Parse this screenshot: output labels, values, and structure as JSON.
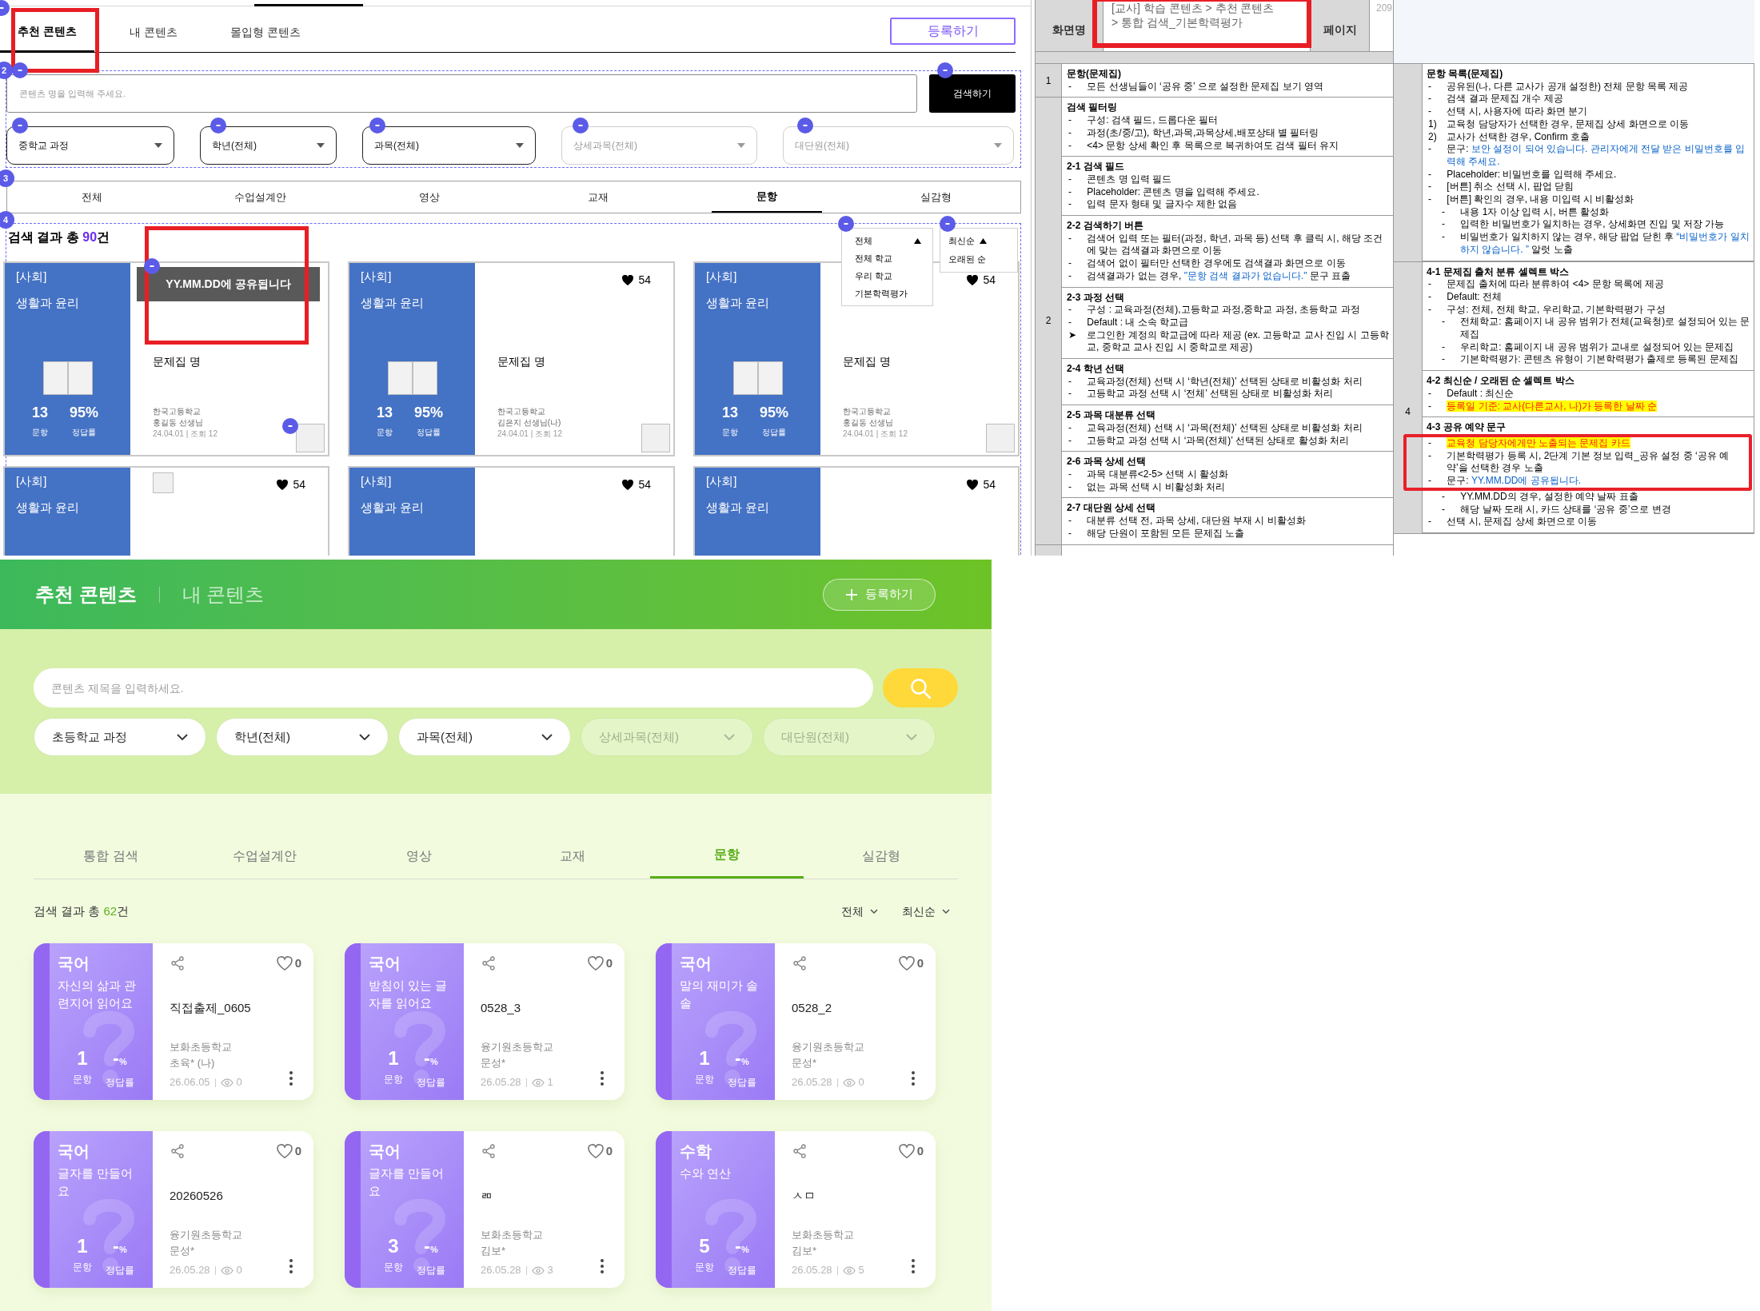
{
  "wireframe": {
    "top_tabs": [
      {
        "label": "추천 콘텐츠",
        "selected": true,
        "highlighted": true
      },
      {
        "label": "내 콘텐츠",
        "selected": false,
        "highlighted": false
      },
      {
        "label": "몰입형 콘텐츠",
        "selected": false,
        "highlighted": false
      }
    ],
    "register_button": "등록하기",
    "section_markers": [
      "2",
      "3",
      "4"
    ],
    "search": {
      "placeholder": "콘텐츠 명을 입력해 주세요.",
      "button": "검색하기"
    },
    "filters": [
      {
        "label": "중학교 과정",
        "disabled": false
      },
      {
        "label": "학년(전체)",
        "disabled": false
      },
      {
        "label": "과목(전체)",
        "disabled": false
      },
      {
        "label": "상세과목(전체)",
        "disabled": true
      },
      {
        "label": "대단원(전체)",
        "disabled": true
      }
    ],
    "category_tabs": [
      {
        "label": "전체",
        "selected": false
      },
      {
        "label": "수업설계안",
        "selected": false
      },
      {
        "label": "영상",
        "selected": false
      },
      {
        "label": "교재",
        "selected": false
      },
      {
        "label": "문항",
        "selected": true
      },
      {
        "label": "실감형",
        "selected": false
      }
    ],
    "result": {
      "label": "검색 결과 총",
      "count": "90",
      "unit": "건"
    },
    "source_menu": [
      {
        "label": "전체",
        "selected": true
      },
      {
        "label": "전체 학교",
        "selected": false
      },
      {
        "label": "우리 학교",
        "selected": false
      },
      {
        "label": "기본학력평가",
        "selected": false
      }
    ],
    "sort_menu": [
      {
        "label": "최신순",
        "selected": true
      },
      {
        "label": "오래된 순",
        "selected": false
      }
    ],
    "cards": [
      {
        "kind": "full",
        "subject": "[사회]",
        "course": "생활과 윤리",
        "question_count": "13",
        "accuracy": "95%",
        "count_label": "문항",
        "accuracy_label": "정답률",
        "notice": "YY.MM.DD에 공유됩니다",
        "title": "문제집 명",
        "school": "한국고등학교",
        "author": "홍길동 선생님",
        "meta": "24.04.01 | 조회 12",
        "highlighted": true
      },
      {
        "kind": "full",
        "subject": "[사회]",
        "course": "생활과 윤리",
        "likes": "54",
        "question_count": "13",
        "accuracy": "95%",
        "count_label": "문항",
        "accuracy_label": "정답률",
        "title": "문제집 명",
        "school": "한국고등학교",
        "author": "김은지 선생님(나)",
        "meta": "24.04.01 | 조회 12",
        "highlighted": false
      },
      {
        "kind": "full",
        "subject": "[사회]",
        "course": "생활과 윤리",
        "likes": "54",
        "question_count": "13",
        "accuracy": "95%",
        "count_label": "문항",
        "accuracy_label": "정답률",
        "title": "문제집 명",
        "school": "한국고등학교",
        "author": "홍길동 선생님",
        "meta": "24.04.01 | 조회 12",
        "highlighted": false
      },
      {
        "kind": "tagged",
        "subject": "[사회]",
        "course": "생활과 윤리",
        "likes": "54",
        "highlighted": false
      },
      {
        "kind": "plain",
        "subject": "[사회]",
        "course": "생활과 윤리",
        "likes": "54",
        "highlighted": false
      },
      {
        "kind": "plain",
        "subject": "[사회]",
        "course": "생활과 윤리",
        "likes": "54",
        "highlighted": false
      }
    ]
  },
  "spec": {
    "header": {
      "label": "화면명",
      "title_lines": [
        "[교사] 학습 콘텐츠 > 추천 콘텐츠",
        "> 통합 검색_기본학력평가"
      ],
      "highlighted": true,
      "page_label": "페이지",
      "page": "209"
    },
    "left_rows": [
      {
        "number": "1",
        "sections": [
          {
            "title": "문항(문제집)",
            "items": [
              {
                "mark": "-",
                "text": "모든 선생님들이 ‘공유 중’ 으로 설정한 문제집 보기 영역"
              }
            ]
          }
        ]
      },
      {
        "number": "2",
        "sections": [
          {
            "title": "검색 필터링",
            "items": [
              {
                "mark": "-",
                "text": "구성: 검색 필드, 드롭다운 필터"
              },
              {
                "mark": "-",
                "text": "과정(초/중/고), 학년,과목,과목상세,배포상태 별 필터링"
              },
              {
                "mark": "-",
                "text": "<4> 문항 상세 확인 후 목록으로 복귀하여도 검색 필터 유지"
              }
            ]
          },
          {
            "title": "2-1 검색 필드",
            "items": [
              {
                "mark": "-",
                "text": "콘텐츠 명 입력 필드"
              },
              {
                "mark": "-",
                "text": "Placeholder: 콘텐츠 명을 입력해 주세요."
              },
              {
                "mark": "-",
                "text": "입력 문자 형태 및 글자수 제한 없음"
              }
            ]
          },
          {
            "title": "2-2 검색하기 버튼",
            "items": [
              {
                "mark": "-",
                "text": "검색어 입력 또는 필터(과정, 학년, 과목 등) 선택 후 클릭 시, 해당 조건에 맞는 검색결과 화면으로 이동"
              },
              {
                "mark": "-",
                "text": "검색어 없이 필터만 선택한 경우에도 검색결과 화면으로 이동"
              },
              {
                "mark": "-",
                "parts": [
                  {
                    "text": "검색결과가 없는 경우, ",
                    "kind": "plain"
                  },
                  {
                    "text": "\"문항 검색 결과가 없습니다.\"",
                    "kind": "quote"
                  },
                  {
                    "text": " 문구 표출",
                    "kind": "plain"
                  }
                ]
              }
            ]
          },
          {
            "title": "2-3 과정 선택",
            "items": [
              {
                "mark": "-",
                "text": "구성 : 교육과정(전체),고등학교 과정,중학교 과정, 초등학교 과정"
              },
              {
                "mark": "-",
                "text": "Default : 내 소속 학교급"
              },
              {
                "mark": "➤",
                "text": "로그인한 계정의 학교급에 따라 제공 (ex. 고등학교 교사 진입 시 고등학교, 중학교 교사 진입 시 중학교로 제공)"
              }
            ]
          },
          {
            "title": "2-4 학년 선택",
            "items": [
              {
                "mark": "-",
                "text": "교육과정(전체) 선택 시 ‘학년(전체)’ 선택된 상태로 비활성화 처리"
              },
              {
                "mark": "-",
                "text": "고등학교 과정 선택 시 ‘전체’ 선택된 상태로 비활성화 처리"
              }
            ]
          },
          {
            "title": "2-5 과목 대분류 선택",
            "items": [
              {
                "mark": "-",
                "text": "교육과정(전체) 선택 시 ‘과목(전체)’ 선택된 상태로 비활성화 처리"
              },
              {
                "mark": "-",
                "text": "고등학교 과정 선택 시 ‘과목(전체)’ 선택된 상태로 활성화 처리"
              }
            ]
          },
          {
            "title": "2-6 과목 상세 선택",
            "items": [
              {
                "mark": "-",
                "text": "과목 대분류<2-5> 선택 시 활성화"
              },
              {
                "mark": "-",
                "text": "없는 과목 선택 시 비활성화 처리"
              }
            ]
          },
          {
            "title": "2-7 대단원 상세 선택",
            "items": [
              {
                "mark": "-",
                "text": "대분류 선택 전, 과목 상세, 대단원 부재 시 비활성화"
              },
              {
                "mark": "-",
                "text": "해당 단원이 포함된 모든 문제집 노출"
              }
            ]
          }
        ]
      }
    ],
    "right_rows": [
      {
        "sections": [
          {
            "title": "문항 목록(문제집)",
            "items": [
              {
                "mark": "-",
                "text": "공유된(나, 다른 교사가 공개 설정한) 전체 문항 목록 제공"
              },
              {
                "mark": "-",
                "text": "검색 결과 문제집 개수 제공"
              },
              {
                "mark": "-",
                "text": "선택 시, 사용자에 따라  화면 분기"
              },
              {
                "mark": "1)",
                "text": "교육청 담당자가 선택한 경우, 문제집 상세 화면으로 이동"
              },
              {
                "mark": "2)",
                "text": "교사가 선택한 경우, Confirm 호출"
              },
              {
                "mark": "-",
                "parts": [
                  {
                    "text": "문구: ",
                    "kind": "plain"
                  },
                  {
                    "text": "보안 설정이 되어 있습니다. 관리자에게 전달 받은 비밀번호를 입력해 주세요.",
                    "kind": "quote"
                  }
                ]
              },
              {
                "mark": "-",
                "text": "Placeholder: 비밀번호를 입력해 주세요."
              },
              {
                "mark": "-",
                "text": "[버튼] 취소 선택 시, 팝업 닫힘"
              },
              {
                "mark": "-",
                "text": "[버튼] 확인의 경우, 내용 미입력 시 비활성화",
                "children": [
                  {
                    "mark": "-",
                    "text": "내용 1자 이상 입력 시, 버튼 활성화"
                  },
                  {
                    "mark": "-",
                    "text": "입력한 비밀번호가 일치하는 경우, 상세화면 진입 및 저장 가능"
                  },
                  {
                    "mark": "-",
                    "parts": [
                      {
                        "text": "비밀번호가 일치하지 않는 경우, 해당 팝업 닫힌 후 ",
                        "kind": "plain"
                      },
                      {
                        "text": "“비밀번호가 일치하지 않습니다. ”",
                        "kind": "quote"
                      },
                      {
                        "text": " 알럿 노출",
                        "kind": "plain"
                      }
                    ]
                  }
                ]
              }
            ]
          }
        ]
      },
      {
        "number": "4",
        "sections": [
          {
            "title": "4-1 문제집 출처 분류 셀렉트 박스",
            "items": [
              {
                "mark": "-",
                "text": "문제집 출처에 따라 분류하여 <4> 문항 목록에 제공"
              },
              {
                "mark": "-",
                "text": "Default:  전체"
              },
              {
                "mark": "-",
                "text": "구성: 전체, 전체 학교, 우리학교, 기본학력평가 구성",
                "children": [
                  {
                    "mark": "-",
                    "text": "전체학교: 홈페이지 내 공유 범위가 전체(교육청)로 설정되어 있는 문제집"
                  },
                  {
                    "mark": "-",
                    "text": "우리학교: 홈페이지 내 공유 범위가 교내로 설정되어 있는 문제집"
                  },
                  {
                    "mark": "-",
                    "text": "기본학력평가: 콘텐츠 유형이 기본학력평가 출제로 등록된 문제집"
                  }
                ]
              }
            ]
          },
          {
            "title": "4-2 최신순 / 오래된 순 셀렉트 박스",
            "items": [
              {
                "mark": "-",
                "text": "Default : 최신순"
              },
              {
                "mark": "-",
                "parts": [
                  {
                    "text": "등록일 기준: 교사(다른교사, 나)가 등록한 날짜 순",
                    "kind": "highlight"
                  }
                ]
              }
            ]
          },
          {
            "title": "4-3 공유 예약 문구",
            "items": [
              {
                "mark": "-",
                "parts": [
                  {
                    "text": "교육청 담당자에게만 노출되는 문제집 카드",
                    "kind": "highlight"
                  }
                ],
                "boxed": true
              },
              {
                "mark": "-",
                "text": "기본학력평가 등록 시, 2단계 기본 정보 입력_공유 설정 중 ‘공유 예약’을 선택한 경우 노출",
                "boxed": true
              },
              {
                "mark": "-",
                "parts": [
                  {
                    "text": "문구: ",
                    "kind": "plain"
                  },
                  {
                    "text": "YY.MM.DD에 공유됩니다.",
                    "kind": "quote"
                  }
                ],
                "boxed": true,
                "children": [
                  {
                    "mark": "-",
                    "text": "YY.MM.DD의 경우, 설정한 예약 날짜 표출",
                    "boxed": false
                  },
                  {
                    "mark": "-",
                    "text": "해당 날짜 도래 시, 카드 상태를 ‘공유 중’으로 변경",
                    "boxed": false
                  }
                ]
              },
              {
                "mark": "-",
                "text": "선택 시, 문제집 상세 화면으로 이동",
                "boxed": false
              }
            ]
          }
        ]
      }
    ]
  },
  "app": {
    "header_tabs": [
      {
        "label": "추천 콘텐츠",
        "selected": true
      },
      {
        "label": "내 콘텐츠",
        "selected": false
      }
    ],
    "register_button": "등록하기",
    "search": {
      "placeholder": "콘텐츠 제목을 입력하세요."
    },
    "filters": [
      {
        "label": "초등학교 과정",
        "disabled": false
      },
      {
        "label": "학년(전체)",
        "disabled": false
      },
      {
        "label": "과목(전체)",
        "disabled": false
      },
      {
        "label": "상세과목(전체)",
        "disabled": true
      },
      {
        "label": "대단원(전체)",
        "disabled": true
      }
    ],
    "category_tabs": [
      {
        "label": "통합 검색",
        "selected": false
      },
      {
        "label": "수업설계안",
        "selected": false
      },
      {
        "label": "영상",
        "selected": false
      },
      {
        "label": "교재",
        "selected": false
      },
      {
        "label": "문항",
        "selected": true
      },
      {
        "label": "실감형",
        "selected": false
      }
    ],
    "result": {
      "label": "검색 결과 총",
      "count": "62",
      "unit": "건"
    },
    "sort_controls": [
      {
        "label": "전체"
      },
      {
        "label": "최신순"
      }
    ],
    "cards": [
      {
        "subject": "국어",
        "unit": "자신의 삶과 관련지어 읽어요",
        "title": "직접출제_0605",
        "school": "보화초등학교",
        "author": "초육* (나)",
        "date": "26.06.05",
        "views": "0",
        "likes": "0",
        "question_count": "1",
        "accuracy": "-",
        "accuracy_unit": "%",
        "count_label": "문항",
        "accuracy_label": "정답률"
      },
      {
        "subject": "국어",
        "unit": "받침이 있는 글자를 읽어요",
        "title": "0528_3",
        "school": "융기원초등학교",
        "author": "문성*",
        "date": "26.05.28",
        "views": "1",
        "likes": "0",
        "question_count": "1",
        "accuracy": "-",
        "accuracy_unit": "%",
        "count_label": "문항",
        "accuracy_label": "정답률"
      },
      {
        "subject": "국어",
        "unit": "말의 재미가 솔솔",
        "title": "0528_2",
        "school": "융기원초등학교",
        "author": "문성*",
        "date": "26.05.28",
        "views": "0",
        "likes": "0",
        "question_count": "1",
        "accuracy": "-",
        "accuracy_unit": "%",
        "count_label": "문항",
        "accuracy_label": "정답률"
      },
      {
        "subject": "국어",
        "unit": "글자를 만들어요",
        "title": "20260526",
        "school": "융기원초등학교",
        "author": "문성*",
        "date": "26.05.28",
        "views": "0",
        "likes": "0",
        "question_count": "1",
        "accuracy": "-",
        "accuracy_unit": "%",
        "count_label": "문항",
        "accuracy_label": "정답률"
      },
      {
        "subject": "국어",
        "unit": "글자를 만들어요",
        "title": "ㄻ",
        "school": "보화초등학교",
        "author": "김보*",
        "date": "26.05.28",
        "views": "3",
        "likes": "0",
        "question_count": "3",
        "accuracy": "-",
        "accuracy_unit": "%",
        "count_label": "문항",
        "accuracy_label": "정답률"
      },
      {
        "subject": "수학",
        "unit": "수와 연산",
        "title": "ㅅㅁ",
        "school": "보화초등학교",
        "author": "김보*",
        "date": "26.05.28",
        "views": "5",
        "likes": "0",
        "question_count": "5",
        "accuracy": "-",
        "accuracy_unit": "%",
        "count_label": "문항",
        "accuracy_label": "정답률"
      }
    ]
  }
}
